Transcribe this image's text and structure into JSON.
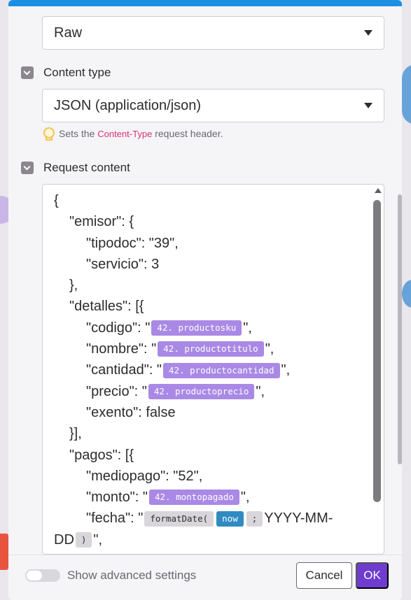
{
  "body_type": {
    "value": "Raw"
  },
  "content_type": {
    "label": "Content type",
    "value": "JSON (application/json)",
    "hint_prefix": "Sets the",
    "hint_token": "Content-Type",
    "hint_suffix": "request header."
  },
  "request_content": {
    "label": "Request content",
    "lines": {
      "l1": "{",
      "emisor_open": "\"emisor\": {",
      "tipodoc": "\"tipodoc\": \"39\",",
      "servicio": "\"servicio\": 3",
      "emisor_close": "},",
      "detalles_open": "\"detalles\": [{",
      "codigo_pre": "\"codigo\": \"",
      "codigo_var": "42. productosku",
      "codigo_post": "\",",
      "nombre_pre": "\"nombre\": \"",
      "nombre_var": "42. productotitulo",
      "nombre_post": "\",",
      "cantidad_pre": "\"cantidad\": \"",
      "cantidad_var": "42. productocantidad",
      "cantidad_post": "\",",
      "precio_pre": "\"precio\": \"",
      "precio_var": "42. productoprecio",
      "precio_post": "\",",
      "exento": "\"exento\": false",
      "detalles_close": "}],",
      "pagos_open": "\"pagos\": [{",
      "mediopago": "\"mediopago\": \"52\",",
      "monto_pre": "\"monto\": \"",
      "monto_var": "42. montopagado",
      "monto_post": "\",",
      "fecha_pre": "\"fecha\": \"",
      "fecha_fn": "formatDate(",
      "fecha_now": "now",
      "fecha_sep": ";",
      "fecha_fmt": "YYYY-MM-",
      "fecha_dd": "DD",
      "fecha_close_fn": ")",
      "fecha_post": "\","
    }
  },
  "footer": {
    "advanced_label": "Show advanced settings",
    "cancel_label": "Cancel",
    "ok_label": "OK"
  },
  "colors": {
    "accent": "#6e3ccf",
    "variable_pill": "#a989e5",
    "keyword_pill": "#2f8bc1",
    "topbar": "#1d8fe3"
  }
}
